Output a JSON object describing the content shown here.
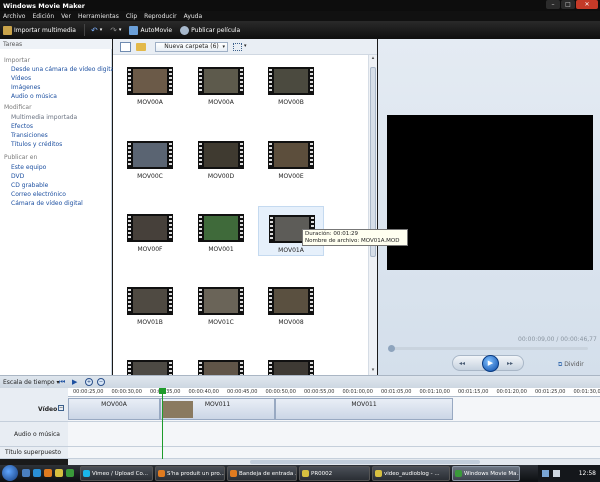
{
  "window": {
    "title": "Windows Movie Maker"
  },
  "menu": [
    "Archivo",
    "Edición",
    "Ver",
    "Herramientas",
    "Clip",
    "Reproducir",
    "Ayuda"
  ],
  "toolbar": {
    "import": "Importar multimedia",
    "automovie": "AutoMovie",
    "publish": "Publicar película"
  },
  "tasks": {
    "header": "Tareas",
    "sections": [
      {
        "title": "Importar",
        "links": [
          "Desde una cámara de vídeo digital",
          "Vídeos",
          "Imágenes",
          "Audio o música"
        ]
      },
      {
        "title": "Modificar",
        "links": [
          "Multimedia importada",
          "Efectos",
          "Transiciones",
          "Títulos y créditos"
        ]
      },
      {
        "title": "Publicar en",
        "links": [
          "Este equipo",
          "DVD",
          "CD grabable",
          "Correo electrónico",
          "Cámara de vídeo digital"
        ]
      }
    ]
  },
  "collection": {
    "folder": "Nueva carpeta (6)",
    "clips": [
      "MOV00A",
      "MOV00A",
      "MOV00B",
      "MOV00C",
      "MOV00D",
      "MOV00E",
      "MOV00F",
      "MOV001",
      "MOV01A",
      "MOV01B",
      "MOV01C",
      "MOV008",
      "",
      "",
      ""
    ],
    "colors": [
      "#6b5a48",
      "#5d5a4c",
      "#4b4a3f",
      "#5a6472",
      "#3f3a30",
      "#5c4e3c",
      "#46403a",
      "#3f6a3a",
      "#5d5c58",
      "#4f4a42",
      "#6a6458",
      "#5a5040",
      "#4d4a44",
      "#605548",
      "#3e3a34"
    ],
    "tooltip": {
      "duration": "Duración: 00:01:29",
      "filename": "Nombre de archivo: MOV01A.MOD"
    }
  },
  "preview": {
    "timecode": "00:00:09,00 / 00:00:46,77",
    "divide": "Dividir"
  },
  "timeline": {
    "scale_label": "Escala de tiempo",
    "ticks": [
      "00:00:25,00",
      "00:00:30,00",
      "00:00:35,00",
      "00:00:40,00",
      "00:00:45,00",
      "00:00:50,00",
      "00:00:55,00",
      "00:01:00,00",
      "00:01:05,00",
      "00:01:10,00",
      "00:01:15,00",
      "00:01:20,00",
      "00:01:25,00",
      "00:01:30,00"
    ],
    "tracks": {
      "video": "Vídeo",
      "audio": "Audio o música",
      "title": "Título superpuesto"
    },
    "clips": [
      "MOV00A",
      "MOV011",
      "MOV011"
    ]
  },
  "taskbar": {
    "tasks": [
      "Vimeo / Upload Co...",
      "S'ha produit un pro...",
      "Bandeja de entrada ...",
      "PR0002",
      "video_audioblog - ...",
      "Windows Movie Ma..."
    ],
    "clock": "12:58"
  }
}
